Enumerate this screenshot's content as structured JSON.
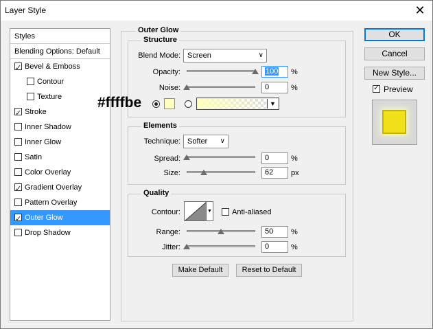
{
  "window": {
    "title": "Layer Style"
  },
  "sidebar": {
    "header": "Styles",
    "blending": "Blending Options: Default",
    "items": [
      {
        "label": "Bevel & Emboss",
        "checked": true,
        "indent": false
      },
      {
        "label": "Contour",
        "checked": false,
        "indent": true
      },
      {
        "label": "Texture",
        "checked": false,
        "indent": true
      },
      {
        "label": "Stroke",
        "checked": true,
        "indent": false
      },
      {
        "label": "Inner Shadow",
        "checked": false,
        "indent": false
      },
      {
        "label": "Inner Glow",
        "checked": false,
        "indent": false
      },
      {
        "label": "Satin",
        "checked": false,
        "indent": false
      },
      {
        "label": "Color Overlay",
        "checked": false,
        "indent": false
      },
      {
        "label": "Gradient Overlay",
        "checked": true,
        "indent": false
      },
      {
        "label": "Pattern Overlay",
        "checked": false,
        "indent": false
      },
      {
        "label": "Outer Glow",
        "checked": true,
        "indent": false,
        "selected": true
      },
      {
        "label": "Drop Shadow",
        "checked": false,
        "indent": false
      }
    ]
  },
  "panel": {
    "title": "Outer Glow",
    "structure": {
      "title": "Structure",
      "blend_mode_label": "Blend Mode:",
      "blend_mode": "Screen",
      "opacity_label": "Opacity:",
      "opacity": "100",
      "opacity_level": 1.0,
      "noise_label": "Noise:",
      "noise": "0",
      "noise_level": 0.0,
      "percent": "%",
      "color_hex_label": "#ffffbe",
      "color": "#ffffbe"
    },
    "elements": {
      "title": "Elements",
      "technique_label": "Technique:",
      "technique": "Softer",
      "spread_label": "Spread:",
      "spread": "0",
      "spread_level": 0.0,
      "size_label": "Size:",
      "size": "62",
      "size_level": 0.25,
      "percent": "%",
      "px": "px"
    },
    "quality": {
      "title": "Quality",
      "contour_label": "Contour:",
      "anti_aliased": "Anti-aliased",
      "range_label": "Range:",
      "range": "50",
      "range_level": 0.5,
      "jitter_label": "Jitter:",
      "jitter": "0",
      "jitter_level": 0.0,
      "percent": "%"
    },
    "make_default": "Make Default",
    "reset_default": "Reset to Default"
  },
  "actions": {
    "ok": "OK",
    "cancel": "Cancel",
    "new_style": "New Style...",
    "preview": "Preview",
    "preview_checked": true
  },
  "colors": {
    "accent": "#3399ff",
    "preview_swatch": "#f2e01b"
  }
}
